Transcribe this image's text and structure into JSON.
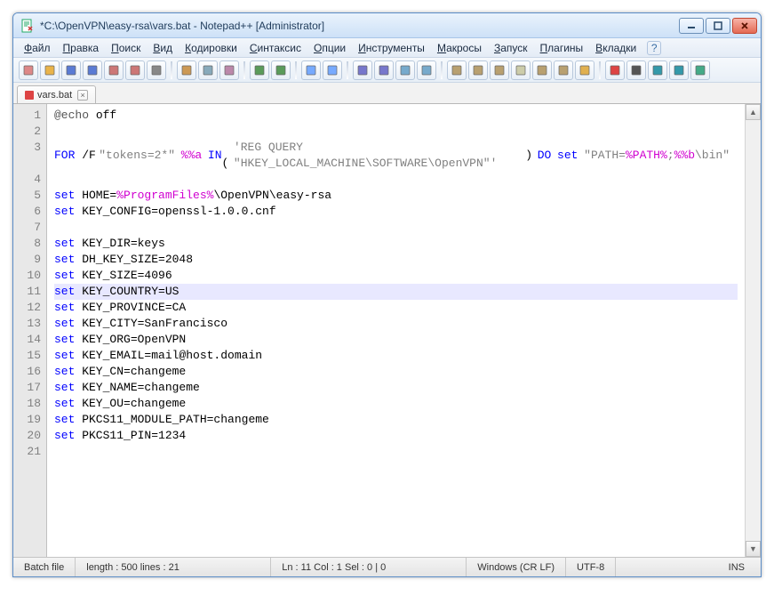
{
  "window": {
    "title": "*C:\\OpenVPN\\easy-rsa\\vars.bat - Notepad++ [Administrator]"
  },
  "menu": {
    "items": [
      "Файл",
      "Правка",
      "Поиск",
      "Вид",
      "Кодировки",
      "Синтаксис",
      "Опции",
      "Инструменты",
      "Макросы",
      "Запуск",
      "Плагины",
      "Вкладки",
      "?"
    ]
  },
  "tabs": {
    "active": {
      "label": "vars.bat"
    }
  },
  "toolbar_icons": [
    "new-file-icon",
    "open-file-icon",
    "save-icon",
    "save-all-icon",
    "close-icon",
    "close-all-icon",
    "print-icon",
    "cut-icon",
    "copy-icon",
    "paste-icon",
    "undo-icon",
    "redo-icon",
    "find-icon",
    "replace-icon",
    "zoom-in-icon",
    "zoom-out-icon",
    "sync-v-icon",
    "sync-h-icon",
    "wordwrap-icon",
    "show-all-icon",
    "indent-guide-icon",
    "udl-icon",
    "doc-map-icon",
    "func-list-icon",
    "folder-icon",
    "record-icon",
    "stop-icon",
    "play-icon",
    "play-multi-icon",
    "save-macro-icon"
  ],
  "code": {
    "lines": [
      [
        {
          "t": "@echo",
          "c": "c-at"
        },
        {
          "t": " off",
          "c": ""
        }
      ],
      [],
      [
        {
          "t": "FOR",
          "c": "c-cmd"
        },
        {
          "t": " /F ",
          "c": ""
        },
        {
          "t": "\"tokens=2*\"",
          "c": "c-str"
        },
        {
          "t": " ",
          "c": ""
        },
        {
          "t": "%%a",
          "c": "c-var"
        },
        {
          "t": " ",
          "c": ""
        },
        {
          "t": "IN",
          "c": "c-cmd"
        },
        {
          "t": " (",
          "c": ""
        },
        {
          "t": "'REG QUERY \"HKEY_LOCAL_MACHINE\\SOFTWARE\\OpenVPN\"'",
          "c": "c-str"
        },
        {
          "t": ") ",
          "c": ""
        },
        {
          "t": "DO",
          "c": "c-cmd"
        },
        {
          "t": " ",
          "c": ""
        },
        {
          "t": "set",
          "c": "c-cmd"
        },
        {
          "t": " ",
          "c": ""
        },
        {
          "t": "\"PATH=",
          "c": "c-str"
        },
        {
          "t": "%PATH%",
          "c": "c-var"
        },
        {
          "t": ";",
          "c": "c-str"
        },
        {
          "t": "%%b",
          "c": "c-var"
        },
        {
          "t": "\\bin\"",
          "c": "c-str"
        }
      ],
      [],
      [
        {
          "t": "set",
          "c": "c-cmd"
        },
        {
          "t": " HOME=",
          "c": ""
        },
        {
          "t": "%ProgramFiles%",
          "c": "c-var"
        },
        {
          "t": "\\OpenVPN\\easy-rsa",
          "c": ""
        }
      ],
      [
        {
          "t": "set",
          "c": "c-cmd"
        },
        {
          "t": " KEY_CONFIG=openssl-1.0.0.cnf",
          "c": ""
        }
      ],
      [],
      [
        {
          "t": "set",
          "c": "c-cmd"
        },
        {
          "t": " KEY_DIR=keys",
          "c": ""
        }
      ],
      [
        {
          "t": "set",
          "c": "c-cmd"
        },
        {
          "t": " DH_KEY_SIZE=2048",
          "c": ""
        }
      ],
      [
        {
          "t": "set",
          "c": "c-cmd"
        },
        {
          "t": " KEY_SIZE=4096",
          "c": ""
        }
      ],
      [
        {
          "t": "set",
          "c": "c-cmd"
        },
        {
          "t": " KEY_COUNTRY=US",
          "c": ""
        }
      ],
      [
        {
          "t": "set",
          "c": "c-cmd"
        },
        {
          "t": " KEY_PROVINCE=CA",
          "c": ""
        }
      ],
      [
        {
          "t": "set",
          "c": "c-cmd"
        },
        {
          "t": " KEY_CITY=SanFrancisco",
          "c": ""
        }
      ],
      [
        {
          "t": "set",
          "c": "c-cmd"
        },
        {
          "t": " KEY_ORG=OpenVPN",
          "c": ""
        }
      ],
      [
        {
          "t": "set",
          "c": "c-cmd"
        },
        {
          "t": " KEY_EMAIL=mail@host.domain",
          "c": ""
        }
      ],
      [
        {
          "t": "set",
          "c": "c-cmd"
        },
        {
          "t": " KEY_CN=changeme",
          "c": ""
        }
      ],
      [
        {
          "t": "set",
          "c": "c-cmd"
        },
        {
          "t": " KEY_NAME=changeme",
          "c": ""
        }
      ],
      [
        {
          "t": "set",
          "c": "c-cmd"
        },
        {
          "t": " KEY_OU=changeme",
          "c": ""
        }
      ],
      [
        {
          "t": "set",
          "c": "c-cmd"
        },
        {
          "t": " PKCS11_MODULE_PATH=changeme",
          "c": ""
        }
      ],
      [
        {
          "t": "set",
          "c": "c-cmd"
        },
        {
          "t": " PKCS11_PIN=1234",
          "c": ""
        }
      ],
      []
    ],
    "highlighted_line": 11,
    "wrap_line": 3
  },
  "status": {
    "filetype": "Batch file",
    "length": "length : 500    lines : 21",
    "pos": "Ln : 11    Col : 1    Sel : 0 | 0",
    "eol": "Windows (CR LF)",
    "enc": "UTF-8",
    "mode": "INS"
  }
}
